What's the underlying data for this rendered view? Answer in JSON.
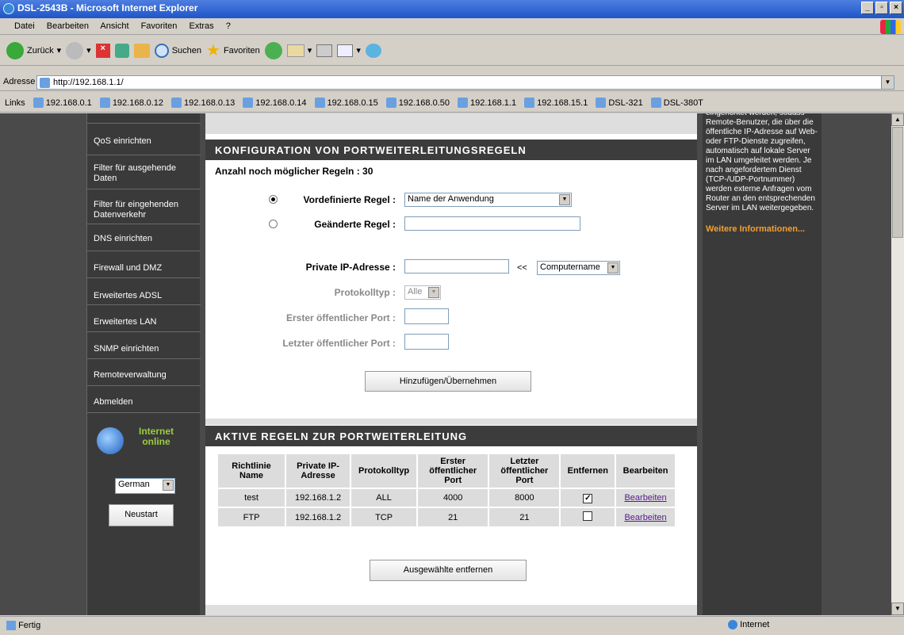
{
  "window": {
    "title": "DSL-2543B - Microsoft Internet Explorer"
  },
  "menu": [
    "Datei",
    "Bearbeiten",
    "Ansicht",
    "Favoriten",
    "Extras",
    "?"
  ],
  "toolbar": {
    "back": "Zurück",
    "search": "Suchen",
    "favorites": "Favoriten"
  },
  "address": {
    "label": "Adresse",
    "url": "http://192.168.1.1/"
  },
  "links": {
    "label": "Links",
    "items": [
      "192.168.0.1",
      "192.168.0.12",
      "192.168.0.13",
      "192.168.0.14",
      "192.168.0.15",
      "192.168.0.50",
      "192.168.1.1",
      "192.168.15.1",
      "DSL-321",
      "DSL-380T"
    ]
  },
  "nav": {
    "items": [
      "QoS einrichten",
      "Filter für ausgehende Daten",
      "Filter für eingehenden Datenverkehr",
      "DNS einrichten",
      "Firewall und DMZ",
      "Erweitertes ADSL",
      "Erweitertes LAN",
      "SNMP einrichten",
      "Remoteverwaltung",
      "Abmelden"
    ],
    "internet_status": "Internet online",
    "language": "German",
    "restart": "Neustart"
  },
  "config": {
    "heading": "KONFIGURATION VON PORTWEITERLEITUNGSREGELN",
    "remaining_label": "Anzahl noch möglicher Regeln :",
    "remaining_value": "30",
    "predefined_label": "Vordefinierte Regel :",
    "predefined_value": "Name der Anwendung",
    "custom_label": "Geänderte Regel :",
    "private_ip_label": "Private IP-Adresse :",
    "arrows": "<<",
    "computer_select": "Computername",
    "protocol_label": "Protokolltyp :",
    "protocol_value": "Alle",
    "first_port_label": "Erster öffentlicher Port :",
    "last_port_label": "Letzter öffentlicher Port :",
    "add_button": "Hinzufügen/Übernehmen"
  },
  "rules": {
    "heading": "AKTIVE REGELN ZUR PORTWEITERLEITUNG",
    "columns": [
      "Richtlinie Name",
      "Private IP-Adresse",
      "Protokolltyp",
      "Erster öffentlicher Port",
      "Letzter öffentlicher Port",
      "Entfernen",
      "Bearbeiten"
    ],
    "rows": [
      {
        "name": "test",
        "ip": "192.168.1.2",
        "proto": "ALL",
        "first": "4000",
        "last": "8000",
        "remove": true,
        "edit": "Bearbeiten"
      },
      {
        "name": "FTP",
        "ip": "192.168.1.2",
        "proto": "TCP",
        "first": "21",
        "last": "21",
        "remove": false,
        "edit": "Bearbeiten"
      }
    ],
    "remove_button": "Ausgewählte entfernen"
  },
  "help": {
    "text": "eingerichtet werden, sodass Remote-Benutzer, die über die öffentliche IP-Adresse auf Web- oder FTP-Dienste zugreifen, automatisch auf lokale Server im LAN umgeleitet werden. Je nach angefordertem Dienst (TCP-/UDP-Portnummer) werden externe Anfragen vom Router an den entsprechenden Server im LAN weitergegeben.",
    "more": "Weitere Informationen..."
  },
  "status": {
    "left": "Fertig",
    "zone": "Internet"
  },
  "colors": {
    "more_link": "#f0a030",
    "sidebar": "#3a3a3a",
    "heading_bar": "#3c3c3c"
  }
}
